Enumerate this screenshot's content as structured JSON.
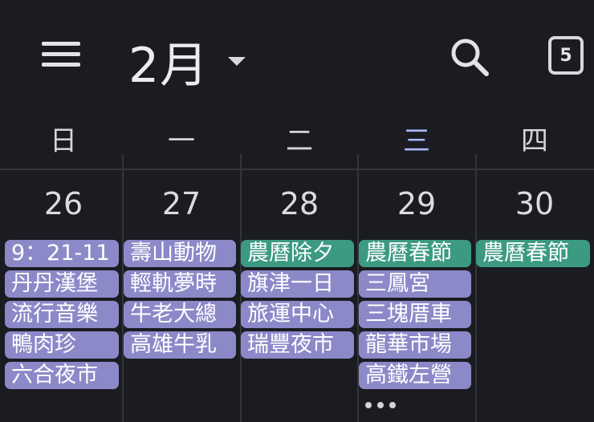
{
  "header": {
    "month_label": "2月",
    "today_badge": "5",
    "icons": [
      "menu-icon",
      "caret-down-icon",
      "search-icon",
      "calendar-today-icon"
    ]
  },
  "weekdays": [
    "日",
    "一",
    "二",
    "三",
    "四"
  ],
  "days": [
    {
      "date": "26",
      "events": [
        "9：21-11",
        "丹丹漢堡",
        "流行音樂",
        "鴨肉珍",
        "六合夜市"
      ]
    },
    {
      "date": "27",
      "events": [
        "壽山動物",
        "輕軌夢時",
        "牛老大總",
        "高雄牛乳"
      ]
    },
    {
      "date": "28",
      "events": [
        "農曆除夕",
        "旗津一日",
        "旅運中心",
        "瑞豐夜市"
      ]
    },
    {
      "date": "29",
      "events": [
        "農曆春節",
        "三鳳宮",
        "三塊厝車",
        "龍華市場",
        "高鐵左營"
      ]
    },
    {
      "date": "30",
      "events": [
        "農曆春節"
      ]
    }
  ],
  "colors": {
    "background": "#1b1c21",
    "event_purple": "#8c89c9",
    "event_green": "#3c9a83",
    "current_weekday": "#a9b8ff"
  }
}
